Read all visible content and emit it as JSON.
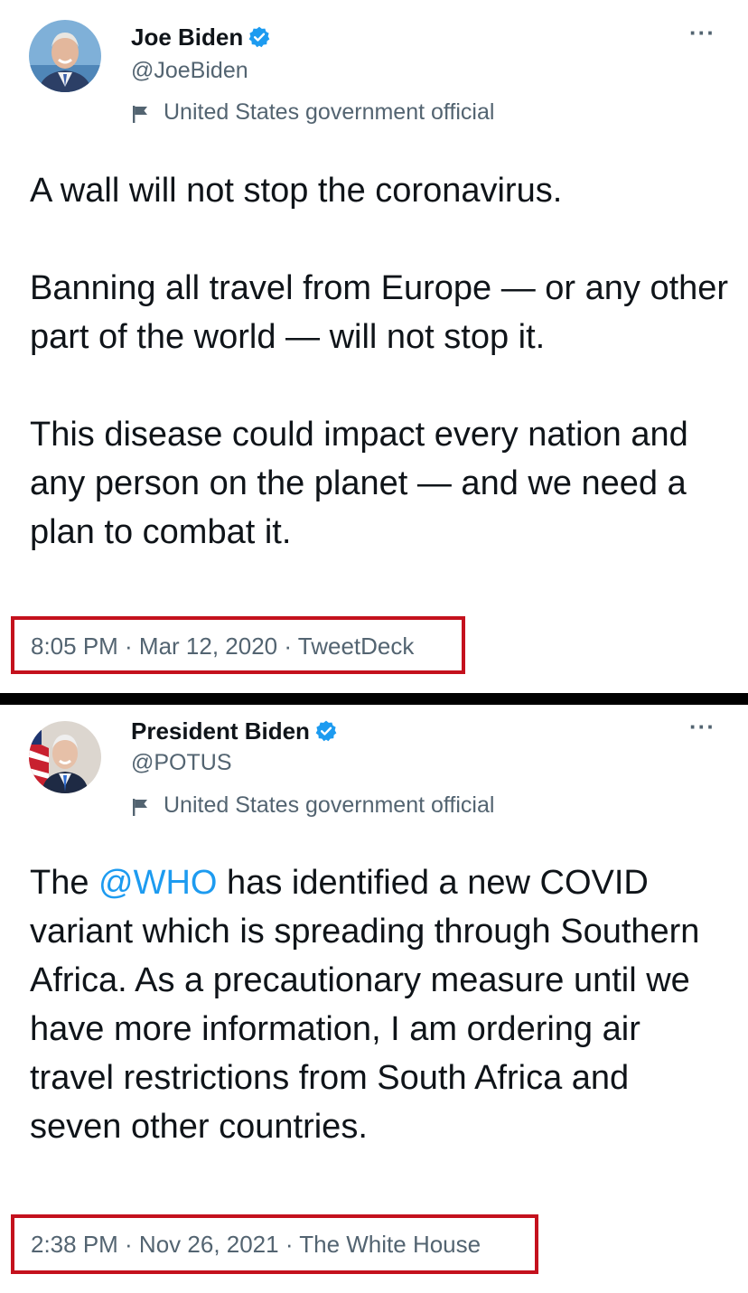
{
  "tweets": [
    {
      "display_name": "Joe Biden",
      "handle": "@JoeBiden",
      "label": "United States government official",
      "more": "···",
      "paragraphs": [
        "A wall will not stop the coronavirus.",
        "Banning all travel from Europe — or any other part of the world — will not stop it.",
        "This disease could impact every nation and any person on the planet — and we need a plan to combat it."
      ],
      "meta": "8:05 PM · Mar 12, 2020 · TweetDeck"
    },
    {
      "display_name": "President Biden",
      "handle": "@POTUS",
      "label": "United States government official",
      "more": "···",
      "body_before_mention": "The ",
      "mention": "@WHO",
      "body_after_mention": " has identified a new COVID variant which is spreading through Southern Africa. As a precautionary measure until we have more information, I am ordering air travel restrictions from South Africa and seven other countries.",
      "meta": "2:38 PM · Nov 26, 2021 · The White House"
    }
  ],
  "icons": {
    "verified": "verified-badge-icon",
    "label": "flag-icon",
    "more": "more-options-icon"
  },
  "colors": {
    "text_primary": "#0f1419",
    "text_secondary": "#536471",
    "verified_blue": "#1d9bf0",
    "mention_blue": "#1d9bf0",
    "highlight_box": "#c4111d",
    "divider": "#000000"
  }
}
